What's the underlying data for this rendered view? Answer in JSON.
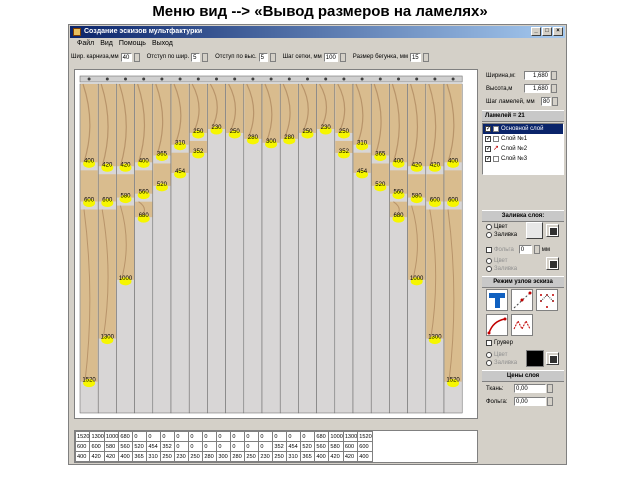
{
  "slide_title": "Меню вид --> «Вывод размеров на ламелях»",
  "window": {
    "title": "Создание эскизов мультфактурки",
    "controls": [
      "_",
      "□",
      "×"
    ]
  },
  "menu": [
    "Файл",
    "Вид",
    "Помощь",
    "Выход"
  ],
  "toolbar": {
    "cornice_label": "Шир. карниза,мм",
    "cornice_value": "40",
    "offset_w_label": "Отступ по шир.",
    "offset_w_value": "5",
    "offset_h_label": "Отступ по выс.",
    "offset_h_value": "5",
    "grid_label": "Шаг сетки, мм",
    "grid_value": "100",
    "runner_label": "Размер бегунка, мм",
    "runner_value": "15"
  },
  "lamellas": {
    "count": 21,
    "top_labels": [
      400,
      420,
      420,
      400,
      365,
      310,
      250,
      230,
      250,
      280,
      300,
      280,
      250,
      230,
      250,
      310,
      365,
      400,
      420,
      420,
      400
    ],
    "mid_labels": [
      600,
      600,
      580,
      560,
      520,
      454,
      352,
      0,
      0,
      0,
      0,
      0,
      0,
      0,
      352,
      454,
      520,
      560,
      580,
      600,
      600
    ],
    "low_labels": [
      1520,
      1300,
      1000,
      680,
      0,
      0,
      0,
      0,
      0,
      0,
      0,
      0,
      0,
      0,
      0,
      0,
      0,
      680,
      1000,
      1300,
      1520
    ],
    "colors": {
      "fabric": "#d9bc8e",
      "fabric_dark": "#b8946a",
      "foil": "#d8d6d6",
      "marker": "#f6f600",
      "rail": "#d0d0d0"
    }
  },
  "bottom_table": {
    "rows": [
      [
        "1520",
        "1300",
        "1000",
        "680",
        "0",
        "0",
        "0",
        "0",
        "0",
        "0",
        "0",
        "0",
        "0",
        "0",
        "0",
        "0",
        "0",
        "680",
        "1000",
        "1300",
        "1520"
      ],
      [
        "600",
        "600",
        "580",
        "560",
        "520",
        "454",
        "352",
        "0",
        "0",
        "0",
        "0",
        "0",
        "0",
        "0",
        "352",
        "454",
        "520",
        "560",
        "580",
        "600",
        "600"
      ],
      [
        "400",
        "420",
        "420",
        "400",
        "365",
        "310",
        "250",
        "230",
        "250",
        "280",
        "300",
        "280",
        "250",
        "230",
        "250",
        "310",
        "365",
        "400",
        "420",
        "420",
        "400"
      ]
    ]
  },
  "right_panel": {
    "width_label": "Ширина,м:",
    "width_value": "1,680",
    "height_label": "Высота,м",
    "height_value": "1,680",
    "step_label": "Шаг ламелей, мм",
    "step_value": "80",
    "lamellas_header": "Ламелей = 21",
    "layers": [
      {
        "name": "Основной слой",
        "checked": true,
        "selected": true,
        "icon": "layer-plain-icon"
      },
      {
        "name": "Слой №1",
        "checked": true,
        "selected": false,
        "icon": "layer-plain-icon"
      },
      {
        "name": "Слой №2",
        "checked": true,
        "selected": false,
        "icon": "layer-curve-icon"
      },
      {
        "name": "Слой №3",
        "checked": true,
        "selected": false,
        "icon": "layer-plain-icon"
      }
    ],
    "fill_header": "Заливка слоя:",
    "fill_color": "Цвет",
    "fill_fill": "Заливка",
    "foil_label": "Фольга",
    "foil_value": "0",
    "foil_unit": "мм",
    "foil_color": "Цвет",
    "foil_fill": "Заливка",
    "mode_header": "Режим узлов эскиза",
    "groove_label": "Грувер",
    "groove_color": "Цвет",
    "groove_fill": "Заливка",
    "prices_header": "Цены слоя",
    "fabric_label": "Ткань:",
    "fabric_value": "0,00",
    "foil_price_label": "Фольга:",
    "foil_price_value": "0,00"
  }
}
